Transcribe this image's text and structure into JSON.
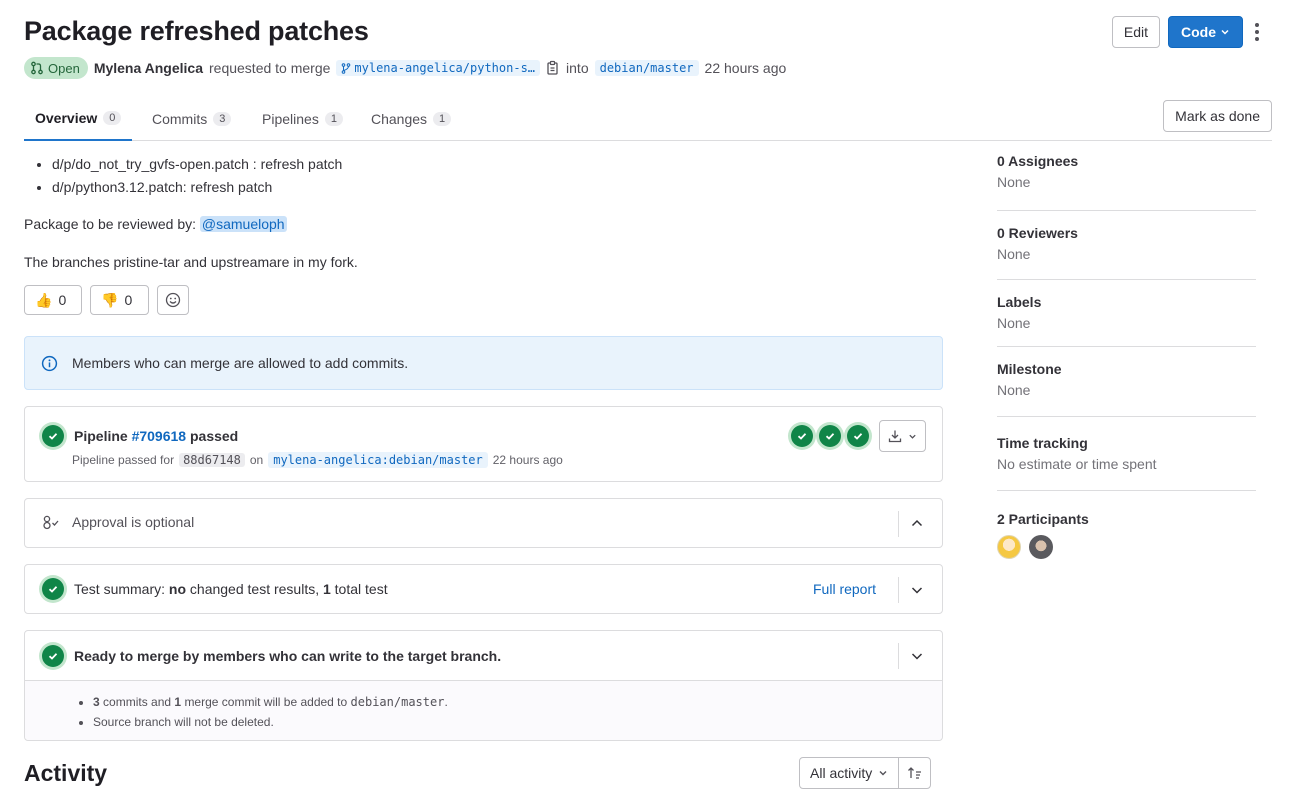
{
  "header": {
    "title": "Package refreshed patches",
    "edit_label": "Edit",
    "code_label": "Code",
    "status": "Open",
    "author": "Mylena Angelica",
    "requested_text": "requested to merge",
    "source_branch": "mylena-angelica/python-s…",
    "into_text": "into",
    "target_branch": "debian/master",
    "time": "22 hours ago"
  },
  "tabs": [
    {
      "label": "Overview",
      "count": "0"
    },
    {
      "label": "Commits",
      "count": "3"
    },
    {
      "label": "Pipelines",
      "count": "1"
    },
    {
      "label": "Changes",
      "count": "1"
    }
  ],
  "mark_done_label": "Mark as done",
  "description": {
    "items": [
      "d/p/do_not_try_gvfs-open.patch : refresh patch",
      "d/p/python3.12.patch: refresh patch"
    ],
    "review_prefix": "Package to be reviewed by:",
    "reviewer": "@samueloph",
    "branches_note": "The branches pristine-tar and upstreamare in my fork."
  },
  "reactions": {
    "thumbs_up": "0",
    "thumbs_down": "0"
  },
  "info_message": "Members who can merge are allowed to add commits.",
  "pipeline": {
    "label": "Pipeline",
    "id": "#709618",
    "status": "passed",
    "passed_for": "Pipeline passed for",
    "sha": "88d67148",
    "on": "on",
    "ref": "mylena-angelica:debian/master",
    "time": "22 hours ago"
  },
  "approval": "Approval is optional",
  "test_summary": {
    "prefix": "Test summary:",
    "no": "no",
    "middle": "changed test results,",
    "count": "1",
    "suffix": "total test",
    "full_report": "Full report"
  },
  "merge": {
    "ready": "Ready to merge by members who can write to the target branch.",
    "commits": "3",
    "commits_text": "commits and",
    "merge_count": "1",
    "merge_text": "merge commit will be added to",
    "target": "debian/master",
    "period": ".",
    "source_note": "Source branch will not be deleted."
  },
  "activity": {
    "title": "Activity",
    "filter": "All activity"
  },
  "sidebar": {
    "assignees": "0 Assignees",
    "assignees_val": "None",
    "reviewers": "0 Reviewers",
    "reviewers_val": "None",
    "labels": "Labels",
    "labels_val": "None",
    "milestone": "Milestone",
    "milestone_val": "None",
    "time_tracking": "Time tracking",
    "time_val": "No estimate or time spent",
    "participants": "2 Participants"
  },
  "colors": {
    "accent": "#1f75cb",
    "success": "#108548",
    "info_bg": "#e9f3fc"
  }
}
